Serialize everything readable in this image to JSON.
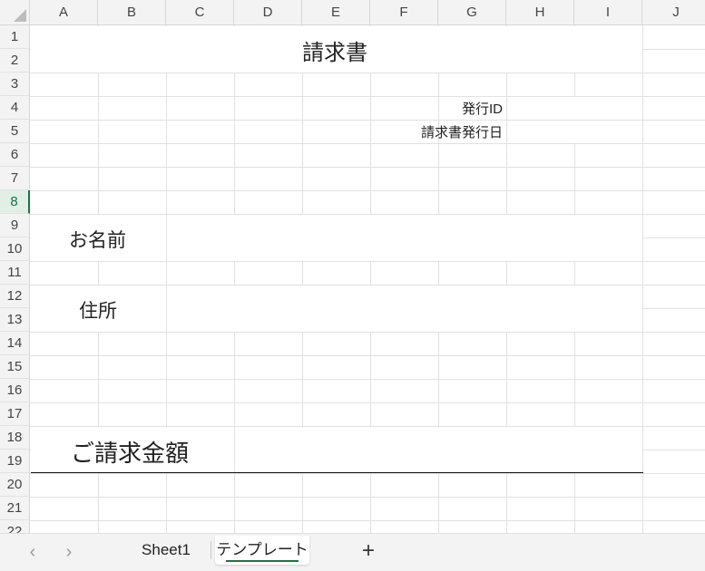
{
  "columns": [
    "A",
    "B",
    "C",
    "D",
    "E",
    "F",
    "G",
    "H",
    "I",
    "J"
  ],
  "rows": [
    "1",
    "2",
    "3",
    "4",
    "5",
    "6",
    "7",
    "8",
    "9",
    "10",
    "11",
    "12",
    "13",
    "14",
    "15",
    "16",
    "17",
    "18",
    "19",
    "20",
    "21",
    "22"
  ],
  "active_row": "8",
  "cells": {
    "title": "請求書",
    "issue_id_label": "発行ID",
    "issue_date_label": "請求書発行日",
    "name_label": "お名前",
    "address_label": "住所",
    "amount_label": "ご請求金額"
  },
  "tabs": {
    "prev_icon": "chevron-left-icon",
    "next_icon": "chevron-right-icon",
    "items": [
      "Sheet1",
      "テンプレート"
    ],
    "active_index": 1,
    "add_label": "+"
  },
  "colors": {
    "accent": "#1e7145",
    "gridline": "#e1e1e1",
    "header_bg": "#f3f3f3"
  }
}
